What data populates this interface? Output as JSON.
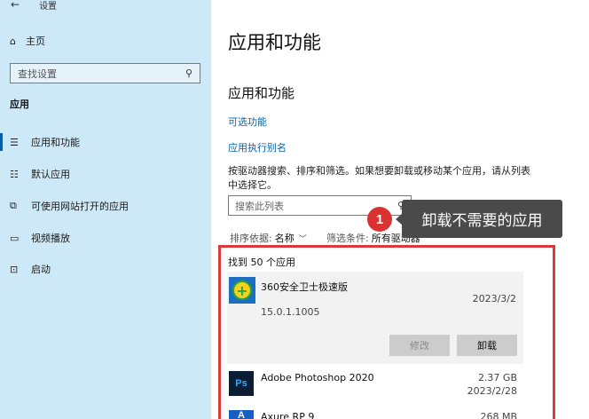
{
  "window": {
    "back_glyph": "←",
    "title": "设置"
  },
  "sidebar": {
    "home_label": "主页",
    "search_placeholder": "查找设置",
    "section_title": "应用",
    "items": [
      {
        "label": "应用和功能",
        "icon": "list-icon",
        "active": true
      },
      {
        "label": "默认应用",
        "icon": "default-apps-icon",
        "active": false
      },
      {
        "label": "可使用网站打开的应用",
        "icon": "web-apps-icon",
        "active": false
      },
      {
        "label": "视频播放",
        "icon": "video-icon",
        "active": false
      },
      {
        "label": "启动",
        "icon": "startup-icon",
        "active": false
      }
    ]
  },
  "main": {
    "page_title": "应用和功能",
    "section_title": "应用和功能",
    "optional_features_link": "可选功能",
    "app_alias_link": "应用执行别名",
    "description": "按驱动器搜索、排序和筛选。如果想要卸载或移动某个应用，请从列表中选择它。",
    "search_placeholder": "搜索此列表",
    "sort_label": "排序依据:",
    "sort_value": "名称",
    "filter_label": "筛选条件:",
    "filter_value": "所有驱动器",
    "found_text": "找到 50 个应用",
    "apps": [
      {
        "name": "360安全卫士极速版",
        "date": "2023/3/2",
        "version": "15.0.1.1005",
        "size": ""
      },
      {
        "name": "Adobe Photoshop 2020",
        "size": "2.37 GB",
        "date": "2023/2/28"
      },
      {
        "name": "Axure RP 9",
        "size": "268 MB",
        "date": ""
      }
    ],
    "modify_button": "修改",
    "uninstall_button": "卸载"
  },
  "annotation": {
    "step_number": "1",
    "callout_text": "卸载不需要的应用"
  }
}
